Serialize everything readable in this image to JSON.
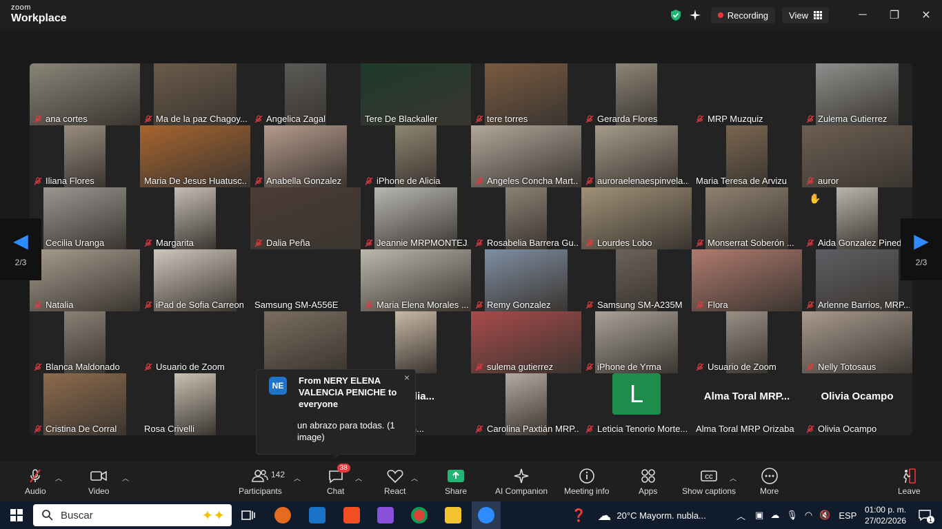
{
  "app": {
    "brand_small": "zoom",
    "brand_big": "Workplace"
  },
  "titlebar": {
    "recording_label": "Recording",
    "view_label": "View",
    "minimize": "─",
    "restore": "❐",
    "close": "✕"
  },
  "pager": {
    "left": "2/3",
    "right": "2/3"
  },
  "tiles": [
    {
      "name": "ana cortes",
      "muted": true,
      "video": "#8a8478"
    },
    {
      "name": "Ma de la paz Chagoy...",
      "muted": true,
      "video": "#6b5a4a"
    },
    {
      "name": "Angelica Zagal",
      "muted": true,
      "video": "#5b5a58"
    },
    {
      "name": "Tere De Blackaller",
      "muted": false,
      "video": "#1d3a2a"
    },
    {
      "name": "tere torres",
      "muted": true,
      "video": "#7a5a40"
    },
    {
      "name": "Gerarda Flores",
      "muted": true,
      "video": "#8c8577"
    },
    {
      "name": "MRP Muzquiz",
      "muted": true,
      "video": ""
    },
    {
      "name": "Zulema Gutierrez",
      "muted": true,
      "video": "#8d8e8c"
    },
    {
      "name": "Iliana Flores",
      "muted": true,
      "video": "#9a8d80"
    },
    {
      "name": "Maria De Jesus Huatusc...",
      "muted": false,
      "video": "#a7642e"
    },
    {
      "name": "Anabella Gonzalez",
      "muted": true,
      "video": "#b59a8c"
    },
    {
      "name": "iPhone de Alicia",
      "muted": true,
      "video": "#8f8570"
    },
    {
      "name": "Angeles Concha Mart...",
      "muted": true,
      "video": "#b2a79b"
    },
    {
      "name": "auroraelenaespinvela...",
      "muted": true,
      "video": "#a69b8a"
    },
    {
      "name": "Maria Teresa de Arvizu",
      "muted": false,
      "video": "#7b6650"
    },
    {
      "name": "auror",
      "muted": true,
      "video": "#6c5e52"
    },
    {
      "name": "Cecilia Uranga",
      "muted": true,
      "video": "#9a9791"
    },
    {
      "name": "Margarita",
      "muted": true,
      "video": "#c4bdb5"
    },
    {
      "name": "Dalia Peña",
      "muted": true,
      "video": "#4b3c34"
    },
    {
      "name": "Jeannie MRPMONTEJ...",
      "muted": true,
      "video": "#b8b7b3"
    },
    {
      "name": "Rosabelia Barrera Gu...",
      "muted": true,
      "video": "#8b8274"
    },
    {
      "name": "Lourdes Lobo",
      "muted": true,
      "video": "#a09177"
    },
    {
      "name": "Monserrat  Soberón ...",
      "muted": true,
      "video": "#8e8170"
    },
    {
      "name": "Aida Gonzalez Pined",
      "muted": true,
      "video": "#b9b4ac",
      "hand": true
    },
    {
      "name": "Natalia",
      "muted": true,
      "video": "#a79d8f"
    },
    {
      "name": "iPad de Sofia Carreon",
      "muted": true,
      "video": "#cfc7bd"
    },
    {
      "name": "Samsung SM-A556E",
      "muted": false,
      "video": ""
    },
    {
      "name": "Maria Elena Morales ...",
      "muted": true,
      "video": "#bdb7ad"
    },
    {
      "name": "Remy Gonzalez",
      "muted": true,
      "video": "#7f8ea3"
    },
    {
      "name": "Samsung SM-A235M",
      "muted": true,
      "video": "#6c6259"
    },
    {
      "name": "Flora",
      "muted": true,
      "video": "#b07a6e"
    },
    {
      "name": "Arlenne Barrios, MRP...",
      "muted": true,
      "video": "#5e5e63"
    },
    {
      "name": "Blanca Maldonado",
      "muted": true,
      "video": "#8a8175"
    },
    {
      "name": "Usuario de Zoom",
      "muted": true,
      "video": ""
    },
    {
      "name": "",
      "muted": true,
      "video": "#7a6d5f"
    },
    {
      "name": "",
      "muted": true,
      "video": "#c8b9a5"
    },
    {
      "name": "sulema gutierrez",
      "muted": true,
      "video": "#a84a4a"
    },
    {
      "name": "iPhone de Yrma",
      "muted": true,
      "video": "#a9a29a"
    },
    {
      "name": "Usuario de Zoom",
      "muted": true,
      "video": "#9b8f85"
    },
    {
      "name": "Nelly Totosaus",
      "muted": true,
      "video": "#a89a8e"
    },
    {
      "name": "Cristina De Corral",
      "muted": true,
      "video": "#8e6b4c"
    },
    {
      "name": "Rosa Crivelli",
      "muted": false,
      "video": "#c9c2b3"
    },
    {
      "name": "",
      "muted": true,
      "video": ""
    },
    {
      "name": "fefelia Martín...",
      "muted": false,
      "video": "",
      "bigname": "Ofelia..."
    },
    {
      "name": "Carolina Paxtián MRP...",
      "muted": true,
      "video": "#b6a9a3"
    },
    {
      "name": "Leticia Tenorio Morte...",
      "muted": true,
      "video": "",
      "avatar": "L"
    },
    {
      "name": "Alma Toral MRP Orizaba",
      "muted": false,
      "video": "",
      "bigname": "Alma Toral MRP..."
    },
    {
      "name": "Olivia Ocampo",
      "muted": true,
      "video": "",
      "bigname": "Olivia Ocampo"
    }
  ],
  "toast": {
    "avatar": "NE",
    "from": "From NERY ELENA VALENCIA PENICHE to everyone",
    "message": "un abrazo para todas. (1 image)",
    "close": "×"
  },
  "toolbar": {
    "audio": "Audio",
    "video": "Video",
    "participants": "Participants",
    "participants_count": "142",
    "chat": "Chat",
    "chat_badge": "38",
    "react": "React",
    "share": "Share",
    "ai_companion": "AI Companion",
    "meeting_info": "Meeting info",
    "apps": "Apps",
    "show_captions": "Show captions",
    "more": "More",
    "leave": "Leave"
  },
  "taskbar": {
    "search_placeholder": "Buscar",
    "weather": "20°C  Mayorm. nubla...",
    "language": "ESP",
    "time": "01:00 p. m.",
    "date": "27/02/2026",
    "notification_count": "1"
  },
  "colors": {
    "accent": "#2d8cff",
    "record": "#e8383d",
    "share": "#22b573",
    "chat_badge": "#e8383d"
  }
}
